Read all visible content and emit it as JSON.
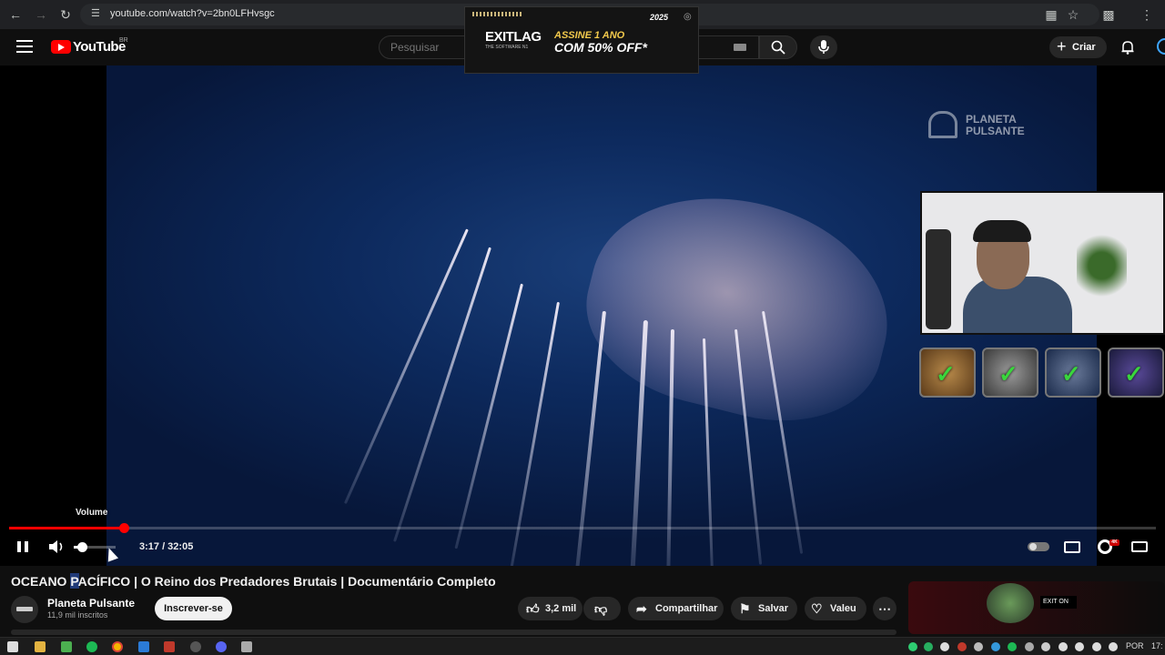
{
  "browser": {
    "url": "youtube.com/watch?v=2bn0LFHvsgc"
  },
  "ad": {
    "year_badge": "2025",
    "brand": "EXITLAG",
    "tagline": "THE SOFTWARE N1",
    "line1": "ASSINE 1 ANO",
    "line2": "COM 50% OFF*"
  },
  "header": {
    "logo_text": "YouTube",
    "country_code": "BR",
    "search_placeholder": "Pesquisar",
    "create_label": "Criar"
  },
  "player": {
    "watermark_line1": "PLANETA",
    "watermark_line2": "PULSANTE",
    "volume_tooltip": "Volume",
    "current_time": "3:17",
    "duration": "32:05",
    "time_display": "3:17 / 32:05",
    "progress_fraction": 0.1,
    "volume_fraction": 0.1
  },
  "video": {
    "title": "OCEANO PACÍFICO | O Reino dos Predadores Brutais | Documentário Completo",
    "channel_name": "Planeta Pulsante",
    "subscribers": "11,9 mil inscritos",
    "subscribe_label": "Inscrever-se",
    "like_count": "3,2 mil",
    "share_label": "Compartilhar",
    "save_label": "Salvar",
    "thanks_label": "Valeu"
  },
  "side_card": {
    "badge_text": "EXIT ON"
  },
  "taskbar": {
    "language": "POR",
    "clock": "17:"
  },
  "colors": {
    "youtube_red": "#ff0000",
    "checkmark_green": "#39d63c",
    "ad_accent": "#f2c94c"
  },
  "icons": [
    "back-icon",
    "forward-icon",
    "reload-icon",
    "menu-icon",
    "search-icon",
    "mic-icon",
    "plus-icon",
    "bell-icon",
    "pause-icon",
    "volume-icon",
    "captions-icon",
    "settings-icon",
    "theater-icon",
    "like-icon",
    "dislike-icon",
    "share-icon",
    "save-icon",
    "thanks-icon",
    "more-icon"
  ]
}
